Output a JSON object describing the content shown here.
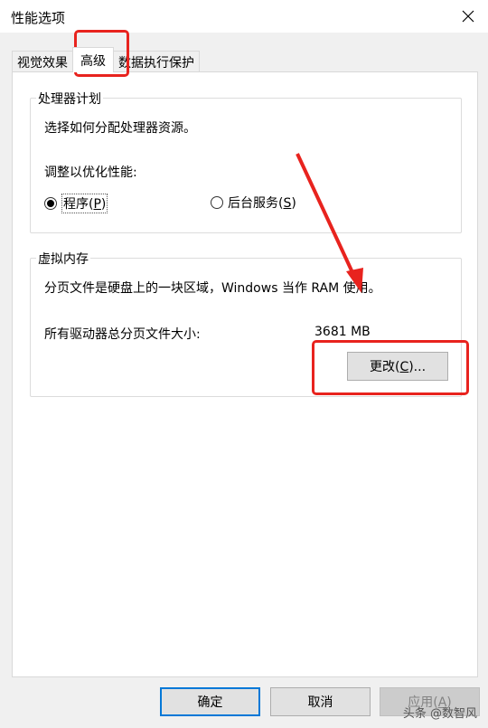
{
  "window": {
    "title": "性能选项",
    "close_icon": "close-icon"
  },
  "tabs": [
    {
      "label": "视觉效果"
    },
    {
      "label": "高级"
    },
    {
      "label": "数据执行保护"
    }
  ],
  "processor": {
    "group_title": "处理器计划",
    "description": "选择如何分配处理器资源。",
    "adjust_label": "调整以优化性能:",
    "options": [
      {
        "label": "程序(",
        "key": "P",
        "suffix": ")",
        "checked": true
      },
      {
        "label": "后台服务(",
        "key": "S",
        "suffix": ")",
        "checked": false
      }
    ]
  },
  "virtual_memory": {
    "group_title": "虚拟内存",
    "description": "分页文件是硬盘上的一块区域，Windows 当作 RAM 使用。",
    "total_label": "所有驱动器总分页文件大小:",
    "total_value": "3681 MB",
    "change_button": {
      "label": "更改(",
      "key": "C",
      "suffix": ")..."
    }
  },
  "footer": {
    "ok": "确定",
    "cancel": "取消",
    "apply": {
      "label": "应用(",
      "key": "A",
      "suffix": ")"
    }
  },
  "watermark": "头条 @数智风",
  "colors": {
    "annotation_red": "#e8231e",
    "default_button_border": "#0078d7"
  }
}
